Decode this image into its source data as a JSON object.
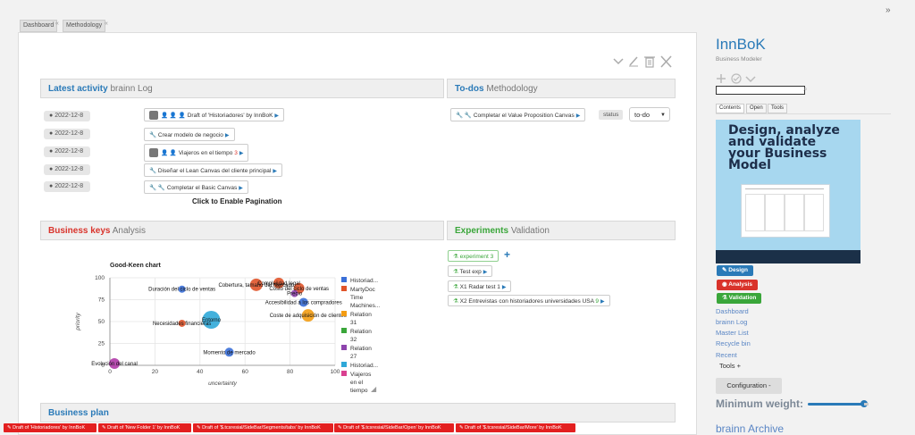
{
  "breadcrumb": {
    "items": [
      "Dashboard",
      "Methodology"
    ]
  },
  "toolbar": {
    "icons": [
      "chevron-down-icon",
      "pencil-icon",
      "trash-icon",
      "close-icon"
    ]
  },
  "latest_activity": {
    "title": "Latest activity",
    "subtitle": "brainn Log",
    "entries": [
      {
        "date": "2022-12-8",
        "text": "Draft of 'Historiadores' by InnBoK",
        "count": ""
      },
      {
        "date": "2022-12-8",
        "text": "Crear modelo de negocio",
        "count": ""
      },
      {
        "date": "2022-12-8",
        "text": "Viajeros en el tiempo",
        "count": "3"
      },
      {
        "date": "2022-12-8",
        "text": "Diseñar el Lean Canvas del cliente principal",
        "count": ""
      },
      {
        "date": "2022-12-8",
        "text": "Completar el Basic Canvas",
        "count": ""
      }
    ],
    "pagination_label": "Click to Enable Pagination"
  },
  "todos": {
    "title": "To-dos",
    "subtitle": "Methodology",
    "item": "Completar el Value Proposition Canvas",
    "status_label": "status",
    "status_value": "to-do"
  },
  "business_keys": {
    "title": "Business keys",
    "subtitle": "Analysis"
  },
  "experiments": {
    "title": "Experiments",
    "subtitle": "Validation",
    "items": [
      {
        "label": "experiment",
        "count": "3"
      },
      {
        "label": "Test exp",
        "count": ""
      },
      {
        "label": "X1 Radar test",
        "count": "1"
      },
      {
        "label": "X2 Entrevistas con historiadores universidades USA",
        "count": "9"
      }
    ]
  },
  "business_plan": {
    "title": "Business plan"
  },
  "sidebar": {
    "app_title": "InnBoK",
    "app_subtitle": "Business Modeler",
    "search_placeholder": "",
    "tabs": [
      "Contents",
      "Open",
      "Tools"
    ],
    "cover": {
      "headline": "Design, analyze and validate your Business Model"
    },
    "badges": [
      {
        "label": "Design",
        "color": "#2a7ab8"
      },
      {
        "label": "Analysis",
        "color": "#d9332b"
      },
      {
        "label": "Validation",
        "color": "#3aa63a"
      }
    ],
    "links": [
      "Dashboard",
      "brainn Log",
      "Master List",
      "Recycle bin",
      "Recent"
    ],
    "tools_label": "Tools +",
    "config_button": "Configuration -",
    "min_weight_label": "Minimum weight:",
    "min_weight_value": 0.92,
    "archive_label": "brainn Archive"
  },
  "drafts_bar": [
    "Draft of 'Historiadores' by InnBoK",
    "Draft of 'New Folder 1' by InnBoK",
    "Draft of '$.tcsresial/SideBar/Segments/tabs' by InnBoK",
    "Draft of '$.tcsresial/SideBar/Open' by InnBoK",
    "Draft of '$.tcsresial/SideBar/More' by InnBoK"
  ],
  "chart_data": {
    "type": "scatter",
    "title": "Good-Keen chart",
    "xlabel": "uncertainty",
    "ylabel": "priority",
    "xlim": [
      0,
      100
    ],
    "ylim": [
      0,
      100
    ],
    "xticks": [
      "0",
      "20",
      "40",
      "60",
      "80",
      "100"
    ],
    "yticks": [
      "0",
      "25",
      "50",
      "75",
      "100"
    ],
    "grid": true,
    "legend_position": "right",
    "points": [
      {
        "label": "Duración del ciclo de ventas",
        "x": 32,
        "y": 87,
        "r": 4,
        "color": "#3a6fd8"
      },
      {
        "label": "Cobertura, tamaño del mercado",
        "x": 65,
        "y": 92,
        "r": 7,
        "color": "#e0542a"
      },
      {
        "label": "Complejidad legal",
        "x": 75,
        "y": 94,
        "r": 6,
        "color": "#e0542a"
      },
      {
        "label": "Costo del ciclo de ventas",
        "x": 84,
        "y": 88,
        "r": 6,
        "color": "#e0542a"
      },
      {
        "label": "Precio",
        "x": 82,
        "y": 82,
        "r": 4,
        "color": "#8e44ad"
      },
      {
        "label": "Accesibilidad a los compradores",
        "x": 86,
        "y": 72,
        "r": 5,
        "color": "#3a6fd8"
      },
      {
        "label": "Coste de adquisición de clientes",
        "x": 88,
        "y": 57,
        "r": 7,
        "color": "#f39c12"
      },
      {
        "label": "Necesidades financieras",
        "x": 32,
        "y": 48,
        "r": 4,
        "color": "#e0542a"
      },
      {
        "label": "Entorno",
        "x": 45,
        "y": 52,
        "r": 10,
        "color": "#2fa8d8"
      },
      {
        "label": "Momento de mercado",
        "x": 53,
        "y": 15,
        "r": 5,
        "color": "#3a6fd8"
      },
      {
        "label": "Evolución del canal",
        "x": 2,
        "y": 2,
        "r": 6,
        "color": "#b03aa8"
      }
    ],
    "legend": [
      {
        "name": "Historiad...",
        "color": "#3a6fd8"
      },
      {
        "name": "MartyDoc Time Machines...",
        "color": "#e0542a"
      },
      {
        "name": "Relation 31",
        "color": "#f39c12"
      },
      {
        "name": "Relation 32",
        "color": "#3aa63a"
      },
      {
        "name": "Relation 27",
        "color": "#8e44ad"
      },
      {
        "name": "Historiad...",
        "color": "#2fa8d8"
      },
      {
        "name": "Viajeros en el tiempo",
        "color": "#d94090"
      }
    ]
  }
}
